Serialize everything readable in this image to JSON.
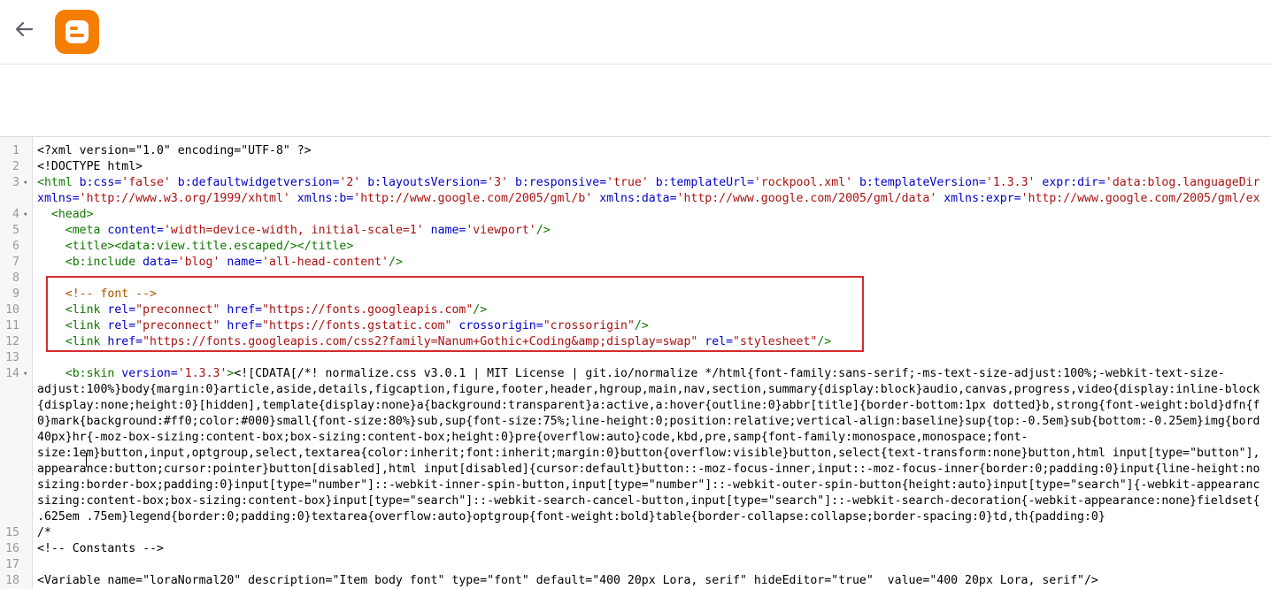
{
  "header": {
    "back_icon": "arrow-left-icon",
    "logo_icon": "blogger-logo-icon",
    "logo_color": "#f57d00"
  },
  "editor": {
    "lines": [
      {
        "n": "1",
        "fold": "",
        "segs": [
          [
            "plain",
            "<?xml version=\"1.0\" encoding=\"UTF-8\" ?>"
          ]
        ]
      },
      {
        "n": "2",
        "fold": "",
        "segs": [
          [
            "plain",
            "<!DOCTYPE html>"
          ]
        ]
      },
      {
        "n": "3",
        "fold": "▾",
        "segs": [
          [
            "tag",
            "<html "
          ],
          [
            "attr",
            "b:css="
          ],
          [
            "val",
            "'false'"
          ],
          [
            "attr",
            " b:defaultwidgetversion="
          ],
          [
            "val",
            "'2'"
          ],
          [
            "attr",
            " b:layoutsVersion="
          ],
          [
            "val",
            "'3'"
          ],
          [
            "attr",
            " b:responsive="
          ],
          [
            "val",
            "'true'"
          ],
          [
            "attr",
            " b:templateUrl="
          ],
          [
            "val",
            "'rockpool.xml'"
          ],
          [
            "attr",
            " b:templateVersion="
          ],
          [
            "val",
            "'1.3.3'"
          ],
          [
            "attr",
            " expr:dir="
          ],
          [
            "val",
            "'data:blog.languageDir"
          ]
        ]
      },
      {
        "n": "",
        "fold": "",
        "segs": [
          [
            "attr",
            "xmlns="
          ],
          [
            "val",
            "'http://www.w3.org/1999/xhtml'"
          ],
          [
            "attr",
            " xmlns:b="
          ],
          [
            "val",
            "'http://www.google.com/2005/gml/b'"
          ],
          [
            "attr",
            " xmlns:data="
          ],
          [
            "val",
            "'http://www.google.com/2005/gml/data'"
          ],
          [
            "attr",
            " xmlns:expr="
          ],
          [
            "val",
            "'http://www.google.com/2005/gml/ex"
          ]
        ]
      },
      {
        "n": "4",
        "fold": "▾",
        "segs": [
          [
            "tag",
            "  <head>"
          ]
        ]
      },
      {
        "n": "5",
        "fold": "",
        "segs": [
          [
            "tag",
            "    <meta "
          ],
          [
            "attr",
            "content="
          ],
          [
            "val",
            "'width=device-width, initial-scale=1'"
          ],
          [
            "attr",
            " name="
          ],
          [
            "val",
            "'viewport'"
          ],
          [
            "tag",
            "/>"
          ]
        ]
      },
      {
        "n": "6",
        "fold": "",
        "segs": [
          [
            "tag",
            "    <title><data:view.title.escaped/></title>"
          ]
        ]
      },
      {
        "n": "7",
        "fold": "",
        "segs": [
          [
            "tag",
            "    <b:include "
          ],
          [
            "attr",
            "data="
          ],
          [
            "val",
            "'blog'"
          ],
          [
            "attr",
            " name="
          ],
          [
            "val",
            "'all-head-content'"
          ],
          [
            "tag",
            "/>"
          ]
        ]
      },
      {
        "n": "8",
        "fold": "",
        "segs": []
      },
      {
        "n": "9",
        "fold": "",
        "segs": [
          [
            "comment",
            "    <!-- font -->"
          ]
        ]
      },
      {
        "n": "10",
        "fold": "",
        "segs": [
          [
            "tag",
            "    <link "
          ],
          [
            "attr",
            "rel="
          ],
          [
            "val",
            "\"preconnect\""
          ],
          [
            "attr",
            " href="
          ],
          [
            "val",
            "\"https://fonts.googleapis.com\""
          ],
          [
            "tag",
            "/>"
          ]
        ]
      },
      {
        "n": "11",
        "fold": "",
        "segs": [
          [
            "tag",
            "    <link "
          ],
          [
            "attr",
            "rel="
          ],
          [
            "val",
            "\"preconnect\""
          ],
          [
            "attr",
            " href="
          ],
          [
            "val",
            "\"https://fonts.gstatic.com\""
          ],
          [
            "attr",
            " crossorigin="
          ],
          [
            "val",
            "\"crossorigin\""
          ],
          [
            "tag",
            "/>"
          ]
        ]
      },
      {
        "n": "12",
        "fold": "",
        "segs": [
          [
            "tag",
            "    <link "
          ],
          [
            "attr",
            "href="
          ],
          [
            "val",
            "\"https://fonts.googleapis.com/css2?family=Nanum+Gothic+Coding&amp;display=swap\""
          ],
          [
            "attr",
            " rel="
          ],
          [
            "val",
            "\"stylesheet\""
          ],
          [
            "tag",
            "/>"
          ]
        ]
      },
      {
        "n": "13",
        "fold": "",
        "segs": []
      },
      {
        "n": "14",
        "fold": "▾",
        "segs": [
          [
            "tag",
            "    <b:skin "
          ],
          [
            "attr",
            "version="
          ],
          [
            "val",
            "'1.3.3'"
          ],
          [
            "tag",
            ">"
          ],
          [
            "plain",
            "<![CDATA[/*! normalize.css v3.0.1 | MIT License | git.io/normalize */html{font-family:sans-serif;-ms-text-size-adjust:100%;-webkit-text-size-"
          ]
        ]
      },
      {
        "n": "",
        "fold": "",
        "segs": [
          [
            "plain",
            "adjust:100%}body{margin:0}article,aside,details,figcaption,figure,footer,header,hgroup,main,nav,section,summary{display:block}audio,canvas,progress,video{display:inline-block"
          ]
        ]
      },
      {
        "n": "",
        "fold": "",
        "segs": [
          [
            "plain",
            "{display:none;height:0}[hidden],template{display:none}a{background:transparent}a:active,a:hover{outline:0}abbr[title]{border-bottom:1px dotted}b,strong{font-weight:bold}dfn{f"
          ]
        ]
      },
      {
        "n": "",
        "fold": "",
        "segs": [
          [
            "plain",
            "0}mark{background:#ff0;color:#000}small{font-size:80%}sub,sup{font-size:75%;line-height:0;position:relative;vertical-align:baseline}sup{top:-0.5em}sub{bottom:-0.25em}img{bord"
          ]
        ]
      },
      {
        "n": "",
        "fold": "",
        "segs": [
          [
            "plain",
            "40px}hr{-moz-box-sizing:content-box;box-sizing:content-box;height:0}pre{overflow:auto}code,kbd,pre,samp{font-family:monospace,monospace;font-"
          ]
        ]
      },
      {
        "n": "",
        "fold": "",
        "segs": [
          [
            "plain",
            "size:1em}button,input,optgroup,select,textarea{color:inherit;font:inherit;margin:0}button{overflow:visible}button,select{text-transform:none}button,html input[type=\"button\"],"
          ]
        ]
      },
      {
        "n": "",
        "fold": "",
        "segs": [
          [
            "plain",
            "appearance:button;cursor:pointer}button[disabled],html input[disabled]{cursor:default}button::-moz-focus-inner,input::-moz-focus-inner{border:0;padding:0}input{line-height:no"
          ]
        ]
      },
      {
        "n": "",
        "fold": "",
        "segs": [
          [
            "plain",
            "sizing:border-box;padding:0}input[type=\"number\"]::-webkit-inner-spin-button,input[type=\"number\"]::-webkit-outer-spin-button{height:auto}input[type=\"search\"]{-webkit-appearanc"
          ]
        ]
      },
      {
        "n": "",
        "fold": "",
        "segs": [
          [
            "plain",
            "sizing:content-box;box-sizing:content-box}input[type=\"search\"]::-webkit-search-cancel-button,input[type=\"search\"]::-webkit-search-decoration{-webkit-appearance:none}fieldset{"
          ]
        ]
      },
      {
        "n": "",
        "fold": "",
        "segs": [
          [
            "plain",
            ".625em .75em}legend{border:0;padding:0}textarea{overflow:auto}optgroup{font-weight:bold}table{border-collapse:collapse;border-spacing:0}td,th{padding:0}"
          ]
        ]
      },
      {
        "n": "15",
        "fold": "",
        "segs": [
          [
            "plain",
            "/*"
          ]
        ]
      },
      {
        "n": "16",
        "fold": "",
        "segs": [
          [
            "plain",
            "<!-- Constants -->"
          ]
        ]
      },
      {
        "n": "17",
        "fold": "",
        "segs": []
      },
      {
        "n": "18",
        "fold": "",
        "segs": [
          [
            "plain",
            "<Variable name=\"loraNormal20\" description=\"Item body font\" type=\"font\" default=\"400 20px Lora, serif\" hideEditor=\"true\"  value=\"400 20px Lora, serif\"/>"
          ]
        ]
      }
    ]
  }
}
